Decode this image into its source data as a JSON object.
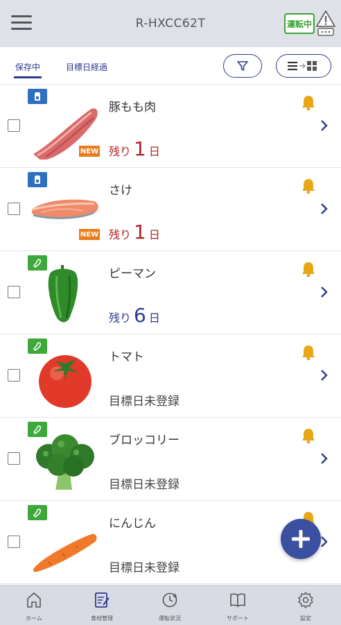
{
  "header": {
    "title": "R-HXCC62T",
    "status": "運転中"
  },
  "tabs": {
    "active": "保存中",
    "other": "目標日経過"
  },
  "items": [
    {
      "name": "豚もも肉",
      "badge": "NEW",
      "remain_prefix": "残り",
      "remain_num": "1",
      "remain_suffix": "日",
      "category": "meat-icon"
    },
    {
      "name": "さけ",
      "badge": "NEW",
      "remain_prefix": "残り",
      "remain_num": "1",
      "remain_suffix": "日",
      "category": "meat-icon"
    },
    {
      "name": "ピーマン",
      "remain_prefix": "残り",
      "remain_num": "6",
      "remain_suffix": "日",
      "category": "vegetable-icon"
    },
    {
      "name": "トマト",
      "status": "目標日未登録",
      "category": "vegetable-icon"
    },
    {
      "name": "ブロッコリー",
      "status": "目標日未登録",
      "category": "vegetable-icon"
    },
    {
      "name": "にんじん",
      "status": "目標日未登録",
      "category": "vegetable-icon"
    }
  ],
  "nav": [
    {
      "label": "ホーム"
    },
    {
      "label": "食材管理"
    },
    {
      "label": "運転状況"
    },
    {
      "label": "サポート"
    },
    {
      "label": "設定"
    }
  ]
}
